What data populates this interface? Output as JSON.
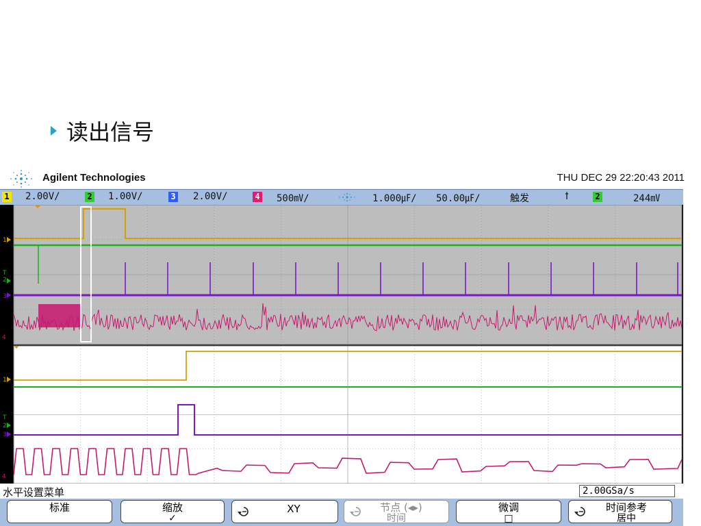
{
  "slide": {
    "title": "读出信号"
  },
  "brand": {
    "name": "Agilent Technologies",
    "timestamp": "THU DEC 29 22:20:43 2011"
  },
  "statusbar": {
    "ch1": {
      "num": "1",
      "scale": "2.00V/",
      "color": "#f2e600"
    },
    "ch2": {
      "num": "2",
      "scale": "1.00V/",
      "color": "#33cc33"
    },
    "ch3": {
      "num": "3",
      "scale": "2.00V/",
      "color": "#2e5cff"
    },
    "ch4": {
      "num": "4",
      "scale": "500㎷/",
      "color": "#e8186e"
    },
    "time_pos": "1.000㎌/",
    "time_scale": "50.00㎌/",
    "trigger_label": "触发",
    "trigger_slope": "ꝉ",
    "trigger_ch": "2",
    "trigger_level": "244㎷"
  },
  "menu": {
    "title": "水平设置菜单",
    "sample_rate": "2.00GSa/s"
  },
  "softkeys": [
    {
      "label": "标准",
      "sub": ""
    },
    {
      "label": "缩放",
      "sub": "✓"
    },
    {
      "label": "XY",
      "sub": ""
    },
    {
      "label": "节点 (◂▸)",
      "sub": "时间"
    },
    {
      "label": "微调",
      "sub": "□"
    },
    {
      "label": "时间参考",
      "sub": "居中"
    }
  ],
  "colors": {
    "ch1": "#d4a100",
    "ch2": "#1bb11b",
    "ch3": "#7a18c8",
    "ch4": "#c8186e"
  }
}
